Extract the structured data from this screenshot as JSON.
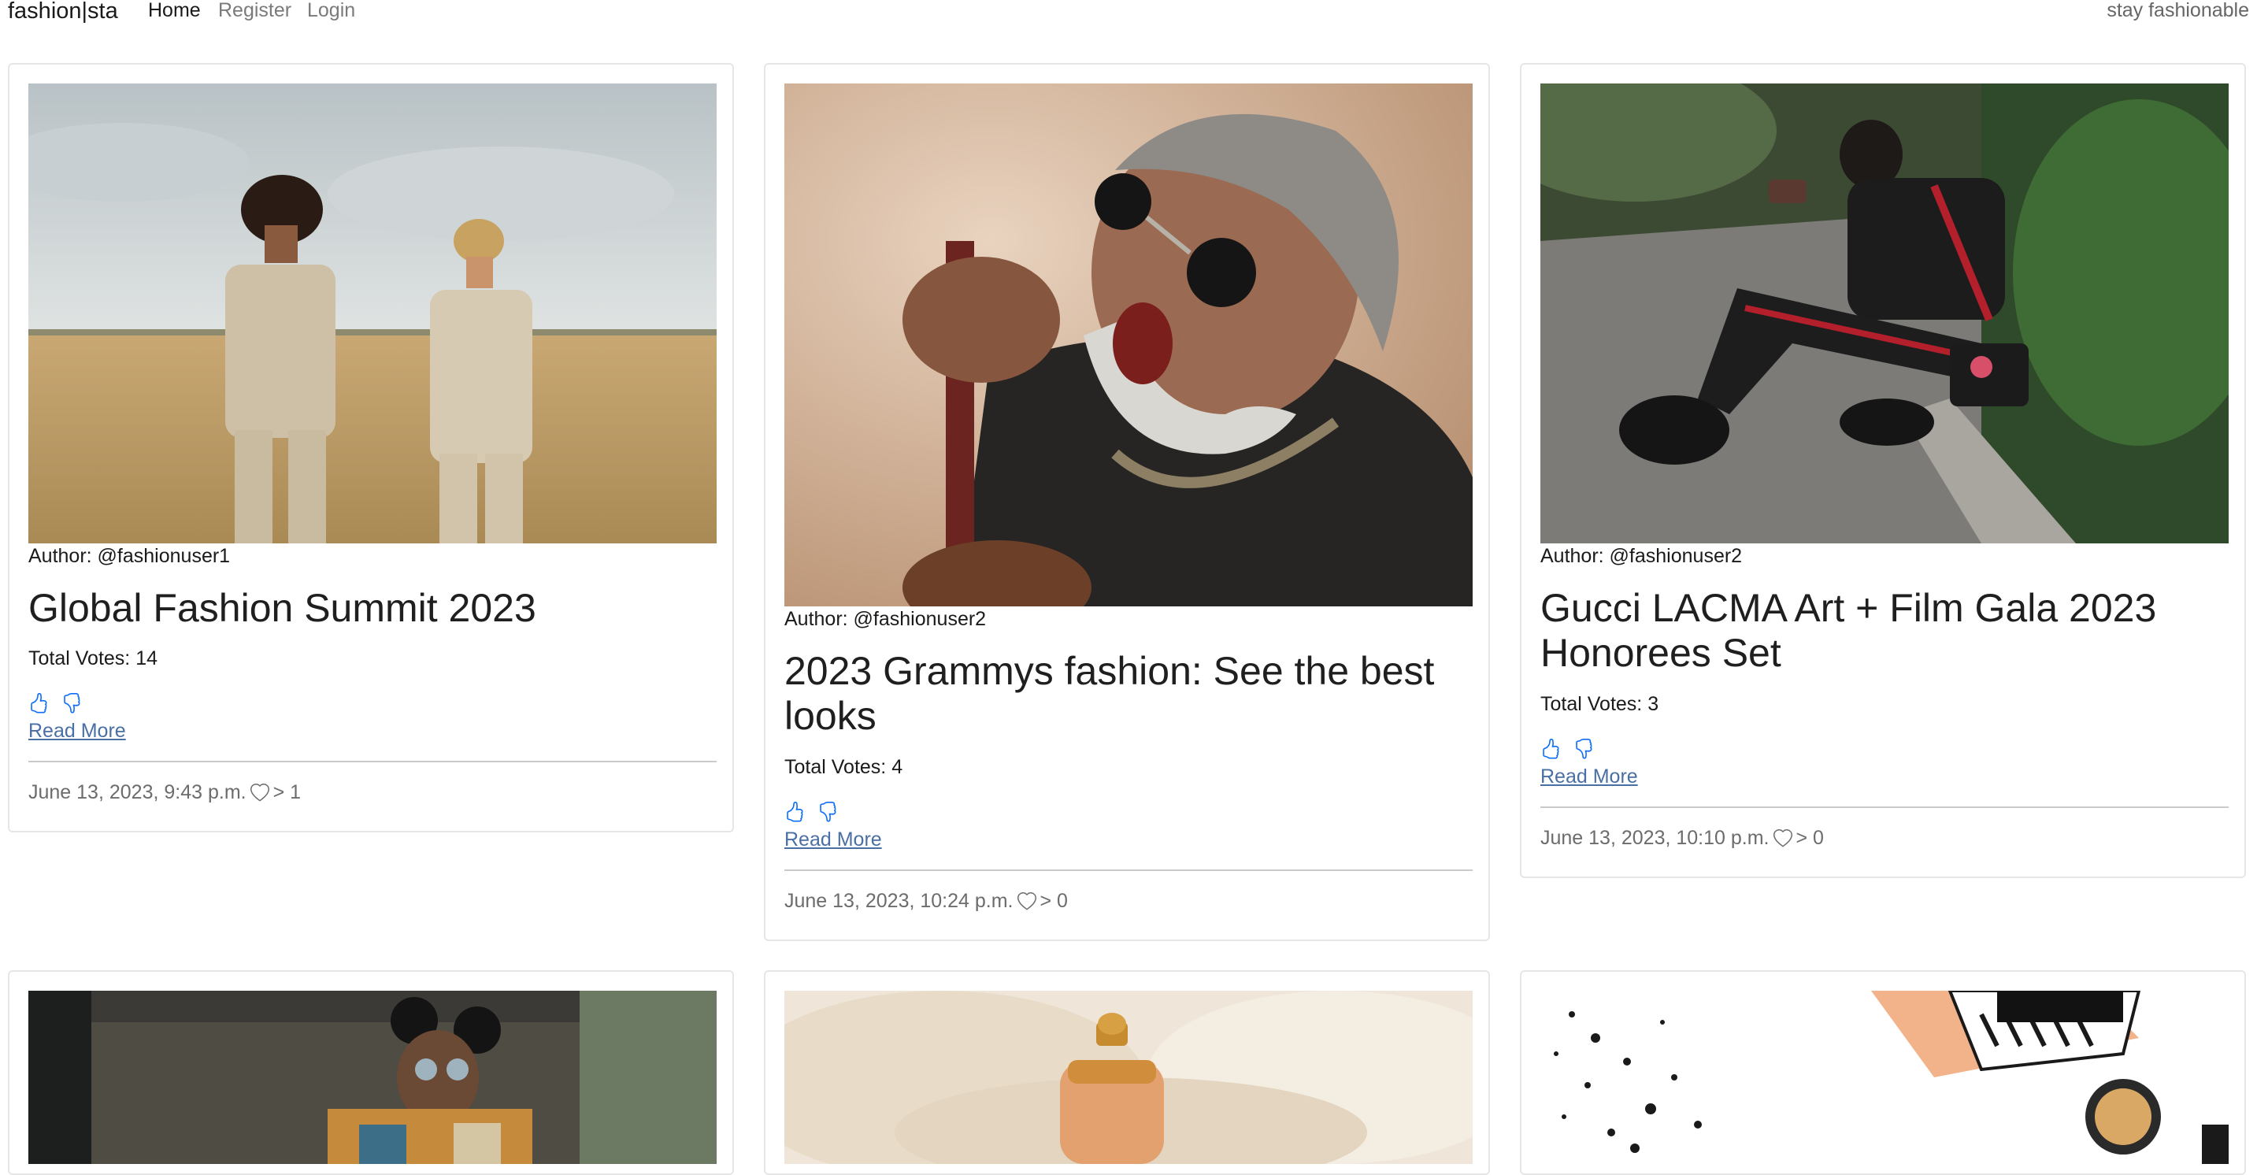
{
  "nav": {
    "brand": "fashion|sta",
    "links": [
      {
        "label": "Home"
      },
      {
        "label": "Register"
      },
      {
        "label": "Login"
      }
    ],
    "tagline": "stay fashionable"
  },
  "posts": [
    {
      "author": "Author: @fashionuser1",
      "title": "Global Fashion Summit 2023",
      "votes": "Total Votes: 14",
      "read_more": "Read More",
      "date": "June 13, 2023, 9:43 p.m.",
      "likes": "> 1"
    },
    {
      "author": "Author: @fashionuser2",
      "title": "2023 Grammys fashion: See the best looks",
      "votes": "Total Votes: 4",
      "read_more": "Read More",
      "date": "June 13, 2023, 10:24 p.m.",
      "likes": "> 0"
    },
    {
      "author": "Author: @fashionuser2",
      "title": "Gucci LACMA Art + Film Gala 2023 Honorees Set",
      "votes": "Total Votes: 3",
      "read_more": "Read More",
      "date": "June 13, 2023, 10:10 p.m.",
      "likes": "> 0"
    }
  ],
  "icons": {
    "like": "thumbs-up-icon",
    "dislike": "thumbs-down-icon",
    "heart": "heart-icon"
  },
  "colors": {
    "link": "#4a6fa5",
    "icon": "#0d6efd"
  }
}
